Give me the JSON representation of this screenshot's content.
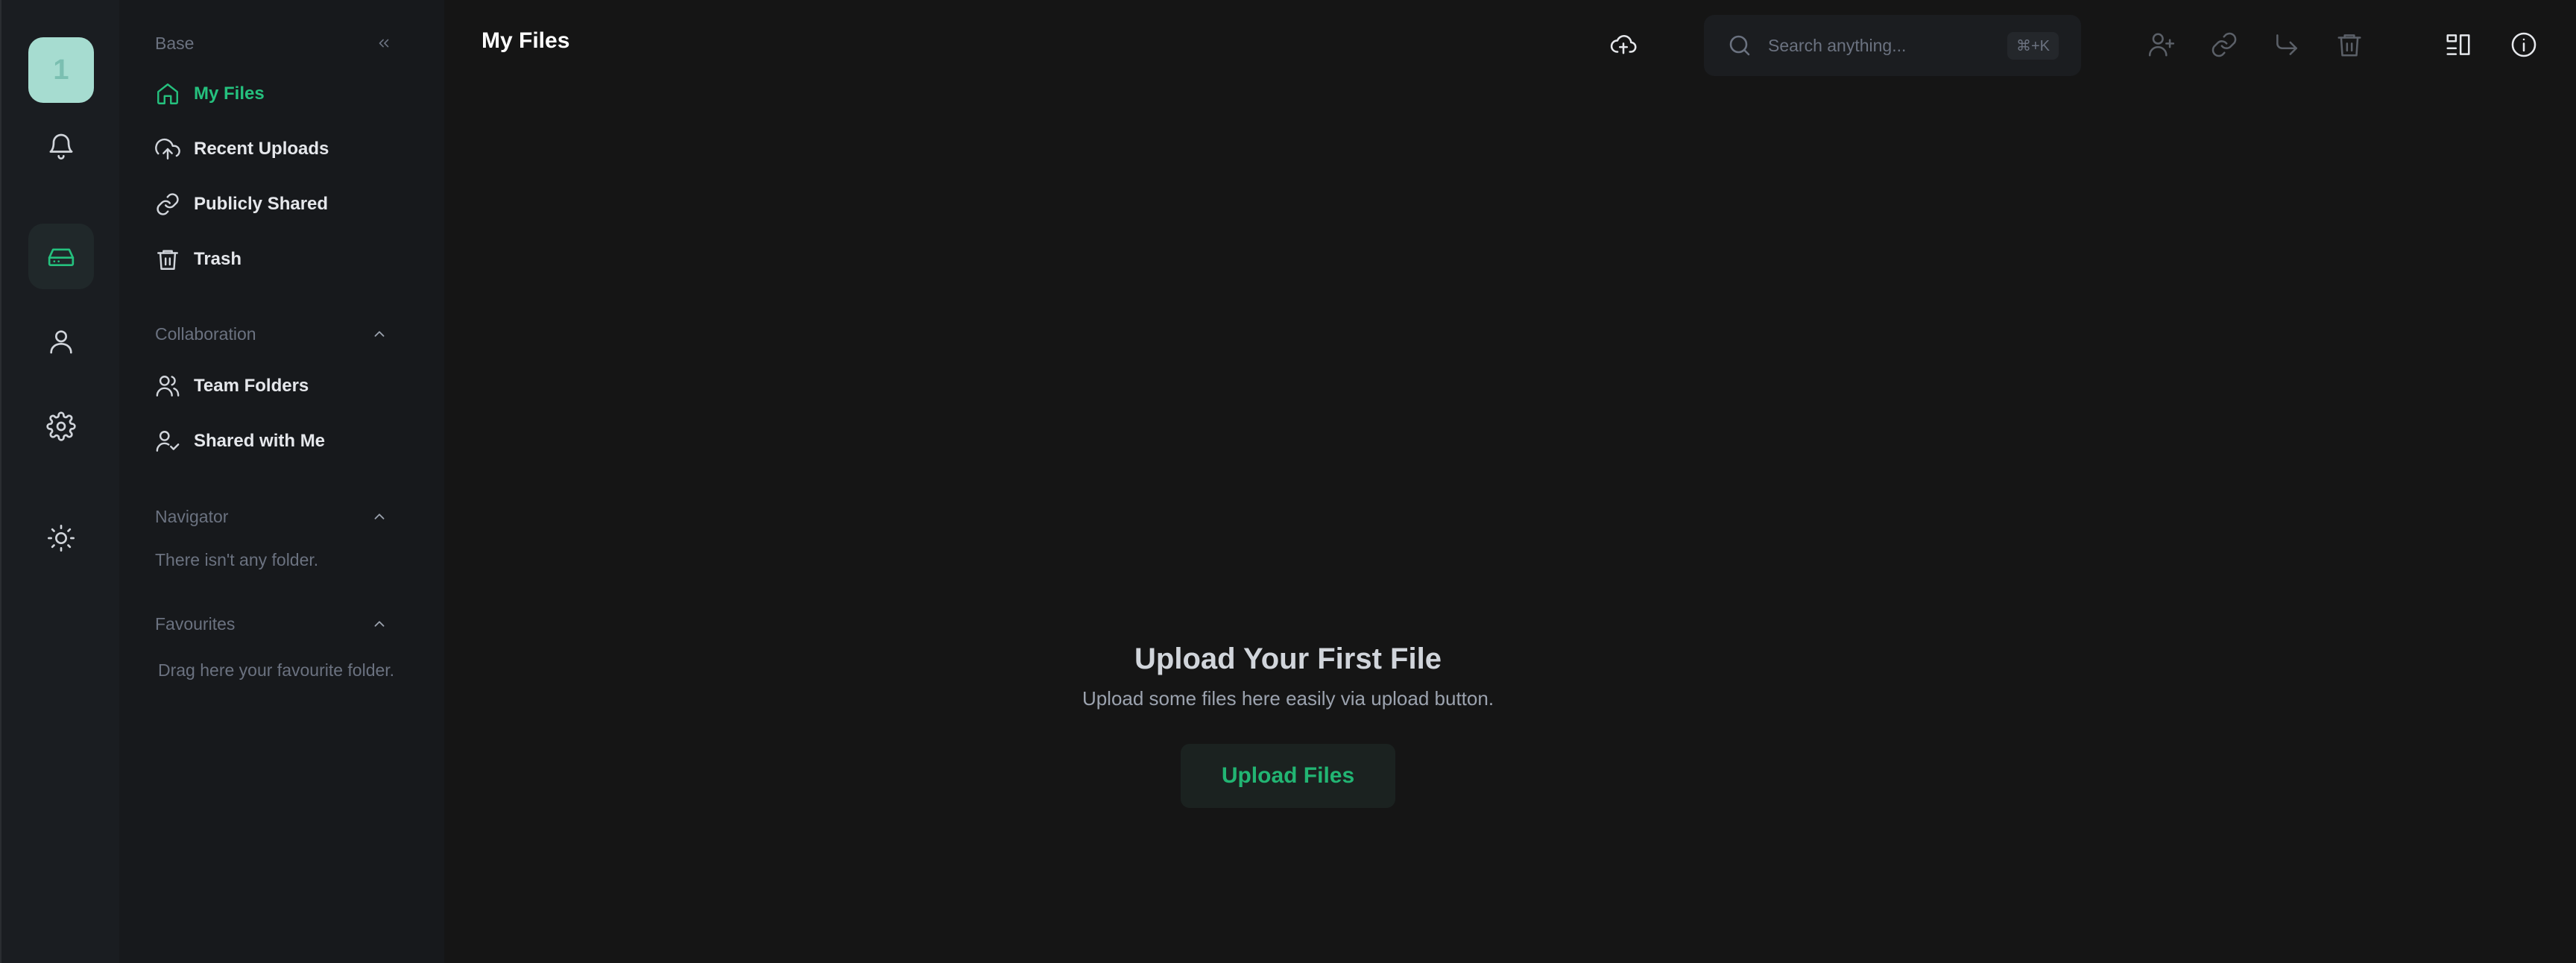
{
  "rail": {
    "avatar_letter": "1",
    "icons": [
      "bell-icon",
      "hard-drive-icon",
      "user-icon",
      "gear-icon",
      "sun-icon"
    ],
    "active": "hard-drive-icon"
  },
  "nav": {
    "base_title": "Base",
    "items": [
      {
        "label": "My Files",
        "icon": "home-icon"
      },
      {
        "label": "Recent Uploads",
        "icon": "cloud-upload-icon"
      },
      {
        "label": "Publicly Shared",
        "icon": "link-icon"
      },
      {
        "label": "Trash",
        "icon": "trash-icon"
      }
    ],
    "collaboration": {
      "title": "Collaboration",
      "items": [
        {
          "label": "Team Folders",
          "icon": "users-icon"
        },
        {
          "label": "Shared with Me",
          "icon": "user-check-icon"
        }
      ]
    },
    "navigator": {
      "title": "Navigator",
      "empty": "There isn't any folder."
    },
    "favourites": {
      "title": "Favourites",
      "empty": "Drag here your favourite folder."
    }
  },
  "header": {
    "title": "My Files",
    "search_placeholder": "Search anything...",
    "search_shortcut": "⌘+K"
  },
  "empty_state": {
    "title": "Upload Your First File",
    "subtitle": "Upload some files here easily via upload button.",
    "button": "Upload Files"
  },
  "colors": {
    "accent": "#25c17e",
    "background": "#151515",
    "sidebar": "#17191c",
    "rail": "#1a1d21",
    "avatar": "#a6dcd0"
  }
}
